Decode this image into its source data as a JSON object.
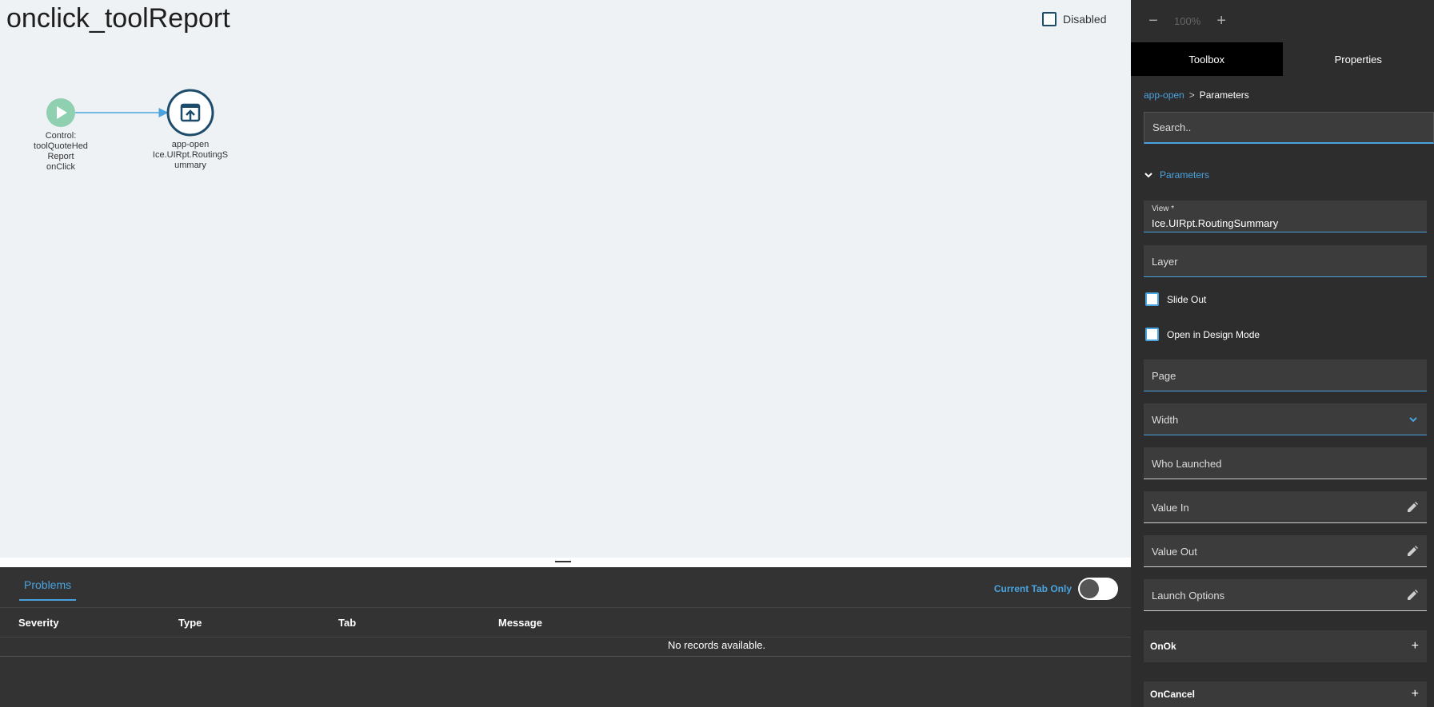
{
  "canvas": {
    "title": "onclick_toolReport",
    "disabled_label": "Disabled"
  },
  "flow": {
    "start_node": {
      "label_lines": [
        "Control:",
        "toolQuoteHed",
        "Report",
        "onClick"
      ]
    },
    "action_node": {
      "label_lines": [
        "app-open",
        "Ice.UIRpt.RoutingS",
        "ummary"
      ]
    }
  },
  "problems": {
    "tab_label": "Problems",
    "current_tab_only_label": "Current Tab Only",
    "columns": [
      "Severity",
      "Type",
      "Tab",
      "Message"
    ],
    "empty_text": "No records available."
  },
  "zoom": {
    "minus": "−",
    "level": "100%",
    "plus": "+"
  },
  "panel": {
    "tabs": [
      "Toolbox",
      "Properties"
    ],
    "breadcrumb": {
      "link": "app-open",
      "separator": ">",
      "current": "Parameters"
    },
    "search_placeholder": "Search..",
    "section_label": "Parameters",
    "view_field": {
      "label": "View *",
      "value": "Ice.UIRpt.RoutingSummary"
    },
    "layer_label": "Layer",
    "slide_out_label": "Slide Out",
    "design_mode_label": "Open in Design Mode",
    "page_label": "Page",
    "width_label": "Width",
    "who_launched_label": "Who Launched",
    "value_in_label": "Value In",
    "value_out_label": "Value Out",
    "launch_options_label": "Launch Options",
    "on_ok_label": "OnOk",
    "on_cancel_label": "OnCancel",
    "plus": "+"
  },
  "colors": {
    "accent": "#4aa3df",
    "start_node": "#8fd0b0",
    "action_node_border": "#1d4b6b"
  }
}
